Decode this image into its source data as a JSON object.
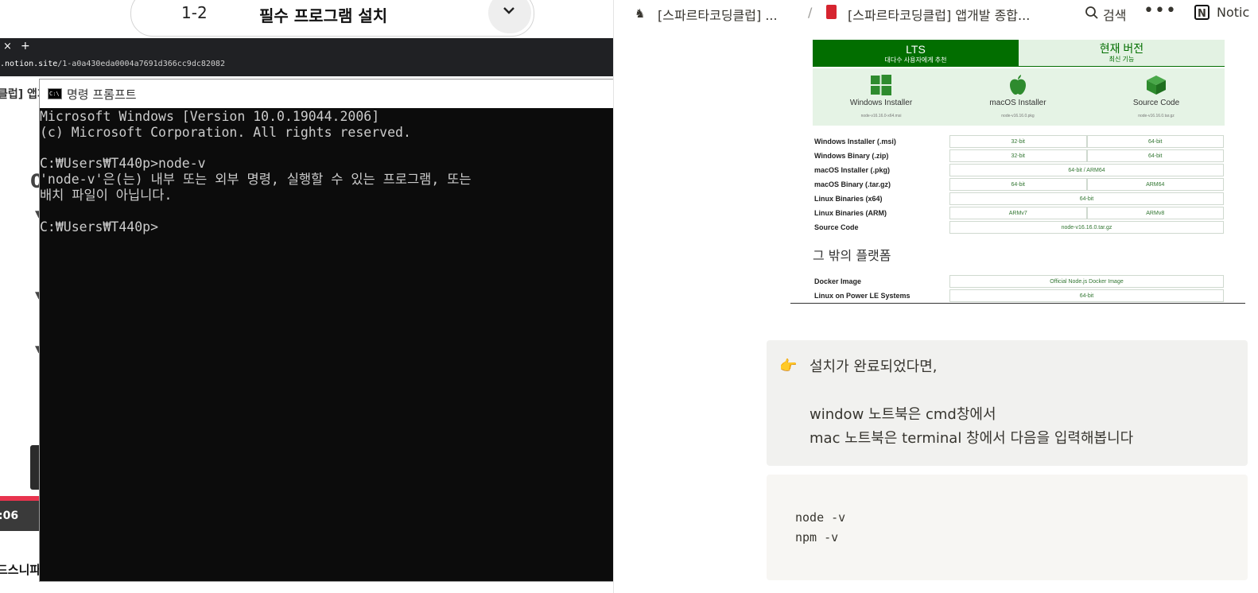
{
  "left_page": {
    "lesson_number": "1-2",
    "lesson_title": "필수 프로그램 설치",
    "tab_close": "×",
    "tab_new": "+",
    "url_host": ".notion.site",
    "url_path": "/1-a0a430eda0004a7691d366cc9dc82082",
    "side_label": "클럽] 앱개",
    "video_time": ":06",
    "bottom_text": "드스니파"
  },
  "cmd": {
    "title": "명령 프롬프트",
    "lines": [
      "Microsoft Windows [Version 10.0.19044.2006]",
      "(c) Microsoft Corporation. All rights reserved.",
      "",
      "C:₩Users₩T440p>node-v",
      "'node-v'은(는) 내부 또는 외부 명령, 실행할 수 있는 프로그램, 또는",
      "배치 파일이 아닙니다.",
      "",
      "C:₩Users₩T440p>"
    ]
  },
  "notion": {
    "breadcrumb_1": "[스파르타코딩클럽] ...",
    "breadcrumb_sep": "/",
    "breadcrumb_2": "[스파르타코딩클럽] 앱개발 종합...",
    "search_label": "검색",
    "more": "•••",
    "notion_logo": "N",
    "notion_label": "Notic",
    "download": {
      "lts_title": "LTS",
      "lts_sub": "대다수 사용자에게 추천",
      "current_title": "현재 버전",
      "current_sub": "최신 기능",
      "installers": [
        {
          "name": "Windows Installer",
          "file": "node-v16.16.0-x64.msi"
        },
        {
          "name": "macOS Installer",
          "file": "node-v16.16.0.pkg"
        },
        {
          "name": "Source Code",
          "file": "node-v16.16.0.tar.gz"
        }
      ],
      "rows": [
        {
          "label": "Windows Installer (.msi)",
          "cells": [
            "32-bit",
            "64-bit"
          ]
        },
        {
          "label": "Windows Binary (.zip)",
          "cells": [
            "32-bit",
            "64-bit"
          ]
        },
        {
          "label": "macOS Installer (.pkg)",
          "cells": [
            "64-bit / ARM64"
          ]
        },
        {
          "label": "macOS Binary (.tar.gz)",
          "cells": [
            "64-bit",
            "ARM64"
          ]
        },
        {
          "label": "Linux Binaries (x64)",
          "cells": [
            "64-bit"
          ]
        },
        {
          "label": "Linux Binaries (ARM)",
          "cells": [
            "ARMv7",
            "ARMv8"
          ]
        },
        {
          "label": "Source Code",
          "cells": [
            "node-v16.16.0.tar.gz"
          ]
        }
      ],
      "other_title": "그 밖의 플랫폼",
      "other_rows": [
        {
          "label": "Docker Image",
          "cells": [
            "Official Node.js Docker Image"
          ]
        },
        {
          "label": "Linux on Power LE Systems",
          "cells": [
            "64-bit"
          ]
        }
      ]
    },
    "callout_icon": "👉",
    "callout_text": "설치가 완료되었다면,\n\nwindow 노트북은 cmd창에서\nmac 노트북은 terminal 창에서 다음을 입력해봅니다",
    "code_lines": [
      "node -v",
      "npm -v"
    ]
  },
  "colors": {
    "node_green": "#026e00",
    "cmd_background": "#0c0c0c",
    "callout_background": "#f1f1ef"
  }
}
